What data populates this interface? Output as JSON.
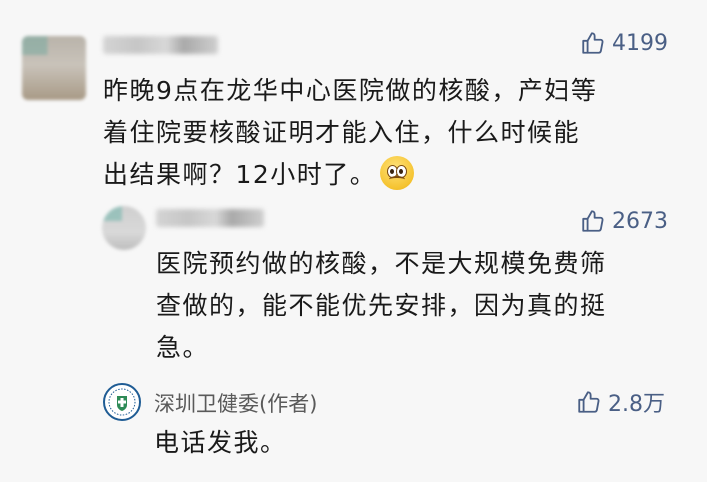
{
  "comments": [
    {
      "likes": "4199",
      "text_lines": [
        "昨晚9点在龙华中心医院做的核酸，产妇等",
        "着住院要核酸证明才能入住，什么时候能",
        "出结果啊？12小时了。"
      ],
      "emoji": "worried-face-emoji"
    },
    {
      "likes": "2673",
      "text_lines": [
        "医院预约做的核酸，不是大规模免费筛",
        "查做的，能不能优先安排，因为真的挺",
        "急。"
      ]
    },
    {
      "author": "深圳卫健委(作者)",
      "likes": "2.8万",
      "text_lines": [
        "电话发我。"
      ]
    }
  ],
  "icons": {
    "like": "thumbs-up-icon",
    "author_logo": "shenzhen-health-commission-logo"
  },
  "colors": {
    "like": "#4a5f85",
    "author_name": "#5a5a5a",
    "logo_blue": "#1f5c94",
    "logo_green": "#2e8b57"
  }
}
